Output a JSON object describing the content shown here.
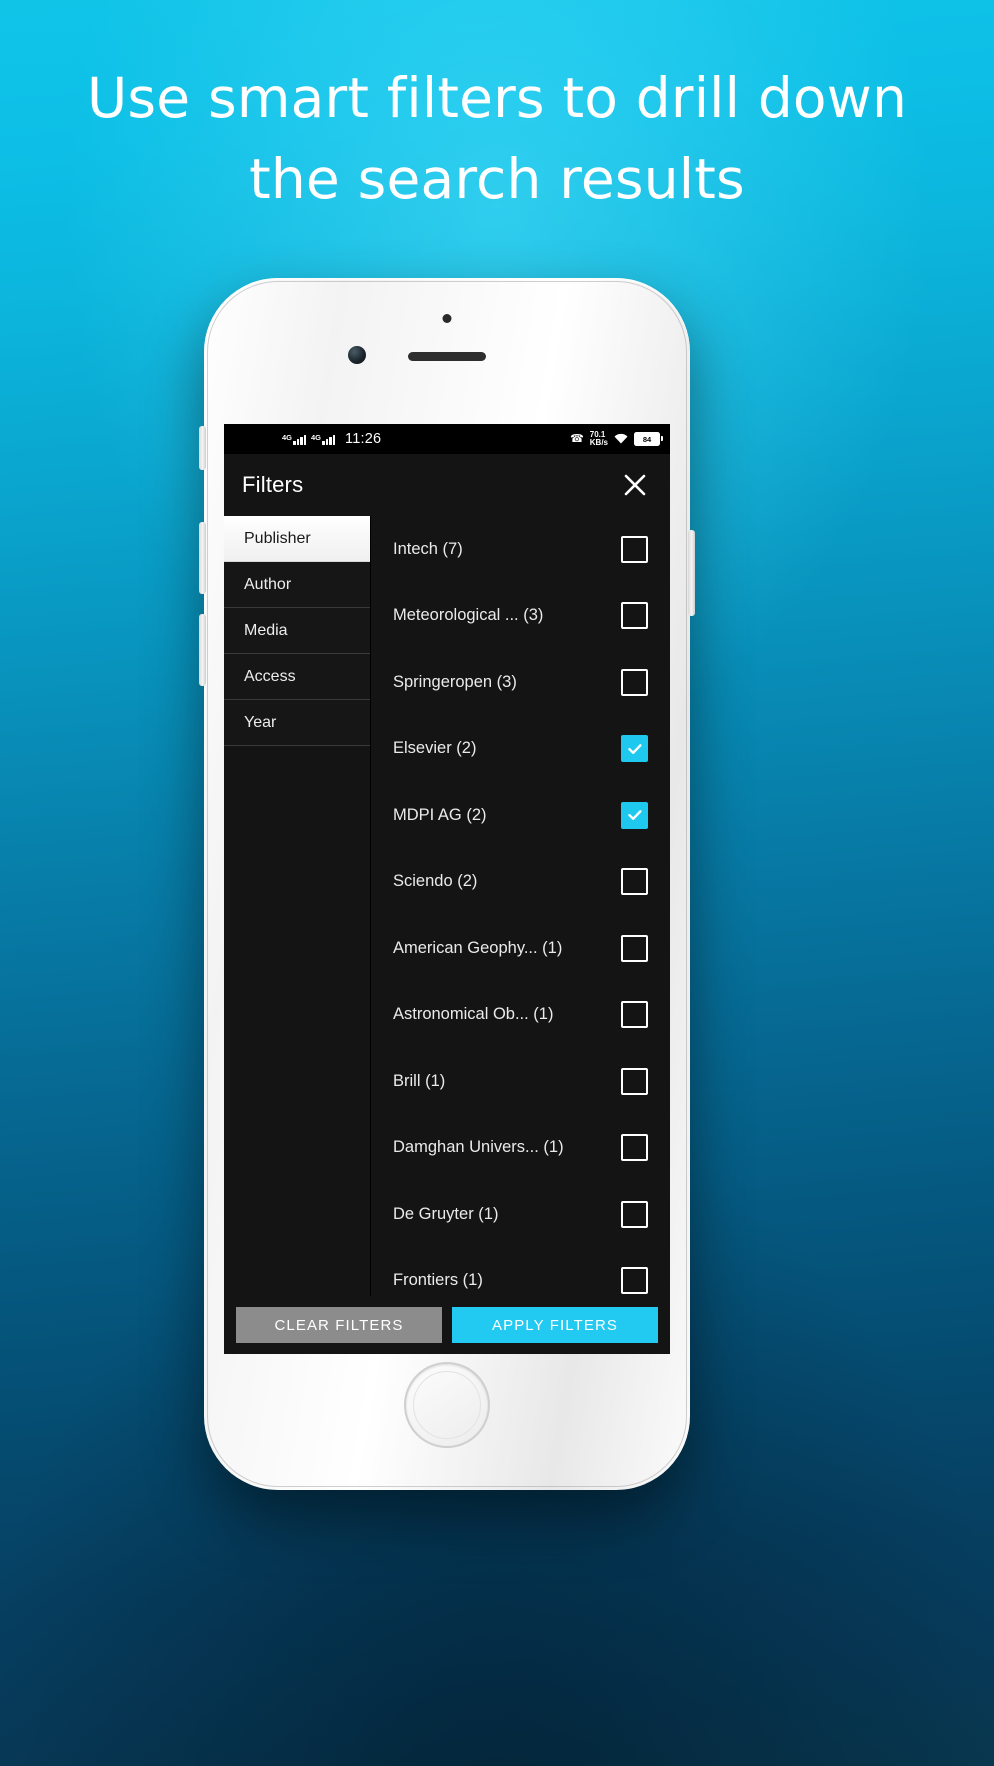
{
  "promo": {
    "headline": "Use smart filters to drill down the search results",
    "background_top_color": "#10c4e8",
    "background_bottom_color": "#08384f"
  },
  "statusbar": {
    "sim1_tag": "4G",
    "sim2_tag": "4G",
    "time": "11:26",
    "call_icon": "call-forward-icon",
    "network_speed_value": "70.1",
    "network_speed_unit": "KB/s",
    "wifi_icon": "wifi-icon",
    "battery_level": "84"
  },
  "appbar": {
    "title": "Filters",
    "close_icon": "close-icon"
  },
  "tabs": [
    {
      "label": "Publisher",
      "active": true
    },
    {
      "label": "Author",
      "active": false
    },
    {
      "label": "Media",
      "active": false
    },
    {
      "label": "Access",
      "active": false
    },
    {
      "label": "Year",
      "active": false
    }
  ],
  "options": [
    {
      "label": "Intech (7)",
      "checked": false
    },
    {
      "label": "Meteorological ... (3)",
      "checked": false
    },
    {
      "label": "Springeropen (3)",
      "checked": false
    },
    {
      "label": "Elsevier (2)",
      "checked": true
    },
    {
      "label": "MDPI AG (2)",
      "checked": true
    },
    {
      "label": "Sciendo (2)",
      "checked": false
    },
    {
      "label": "American Geophy... (1)",
      "checked": false
    },
    {
      "label": "Astronomical Ob... (1)",
      "checked": false
    },
    {
      "label": "Brill (1)",
      "checked": false
    },
    {
      "label": "Damghan Univers... (1)",
      "checked": false
    },
    {
      "label": "De Gruyter (1)",
      "checked": false
    },
    {
      "label": "Frontiers (1)",
      "checked": false
    }
  ],
  "actions": {
    "clear_label": "CLEAR FILTERS",
    "apply_label": "APPLY FILTERS",
    "clear_color": "#8c8c8c",
    "apply_color": "#22c9f0"
  },
  "accent_color": "#1fc8ee"
}
